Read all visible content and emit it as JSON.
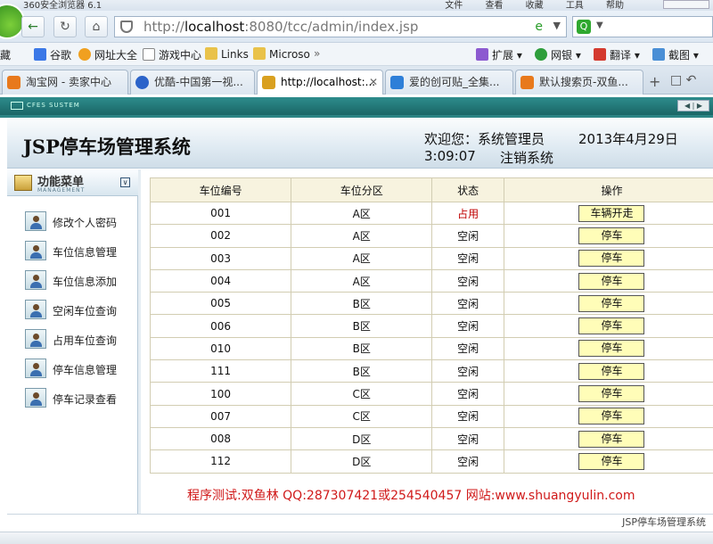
{
  "browser": {
    "title": "360安全浏览器 6.1",
    "menu": [
      "文件",
      "查看",
      "收藏",
      "工具",
      "帮助"
    ],
    "url_prefix": "http://",
    "url_host": "localhost",
    "url_rest": ":8080/tcc/admin/index.jsp",
    "favorites": [
      "藏",
      "谷歌",
      "网址大全",
      "游戏中心",
      "Links",
      "Microso",
      "»"
    ],
    "extensions": [
      "扩展",
      "网银",
      "翻译",
      "截图"
    ],
    "tabs": [
      {
        "label": "淘宝网 - 卖家中心",
        "color": "#e8791c"
      },
      {
        "label": "优酷-中国第一视...",
        "color": "#2b63c9"
      },
      {
        "label": "http://localhost:...",
        "color": "#d9a020"
      },
      {
        "label": "爱的创可贴_全集...",
        "color": "#2e7fd8"
      },
      {
        "label": "默认搜索页-双鱼...",
        "color": "#e8791c"
      }
    ]
  },
  "system_bar": {
    "label": "CFES SUSTEM"
  },
  "header": {
    "system_name": "JSP停车场管理系统",
    "welcome": "欢迎您：系统管理员",
    "date": "2013年4月29日",
    "time": "3:09:07",
    "logout": "注销系统"
  },
  "sidebar": {
    "title": "功能菜单",
    "subtitle": "MANAGEMENT",
    "items": [
      {
        "label": "修改个人密码"
      },
      {
        "label": "车位信息管理"
      },
      {
        "label": "车位信息添加"
      },
      {
        "label": "空闲车位查询"
      },
      {
        "label": "占用车位查询"
      },
      {
        "label": "停车信息管理"
      },
      {
        "label": "停车记录查看"
      }
    ]
  },
  "table": {
    "headers": [
      "车位编号",
      "车位分区",
      "状态",
      "操作"
    ],
    "rows": [
      {
        "id": "001",
        "zone": "A区",
        "status": "占用",
        "action": "车辆开走",
        "occupied": true
      },
      {
        "id": "002",
        "zone": "A区",
        "status": "空闲",
        "action": "停车",
        "occupied": false
      },
      {
        "id": "003",
        "zone": "A区",
        "status": "空闲",
        "action": "停车",
        "occupied": false
      },
      {
        "id": "004",
        "zone": "A区",
        "status": "空闲",
        "action": "停车",
        "occupied": false
      },
      {
        "id": "005",
        "zone": "B区",
        "status": "空闲",
        "action": "停车",
        "occupied": false
      },
      {
        "id": "006",
        "zone": "B区",
        "status": "空闲",
        "action": "停车",
        "occupied": false
      },
      {
        "id": "010",
        "zone": "B区",
        "status": "空闲",
        "action": "停车",
        "occupied": false
      },
      {
        "id": "111",
        "zone": "B区",
        "status": "空闲",
        "action": "停车",
        "occupied": false
      },
      {
        "id": "100",
        "zone": "C区",
        "status": "空闲",
        "action": "停车",
        "occupied": false
      },
      {
        "id": "007",
        "zone": "C区",
        "status": "空闲",
        "action": "停车",
        "occupied": false
      },
      {
        "id": "008",
        "zone": "D区",
        "status": "空闲",
        "action": "停车",
        "occupied": false
      },
      {
        "id": "112",
        "zone": "D区",
        "status": "空闲",
        "action": "停车",
        "occupied": false
      }
    ]
  },
  "footer_note": "程序测试:双鱼林 QQ:287307421或254540457 网站:www.shuangyulin.com",
  "copyright": "JSP停车场管理系统"
}
